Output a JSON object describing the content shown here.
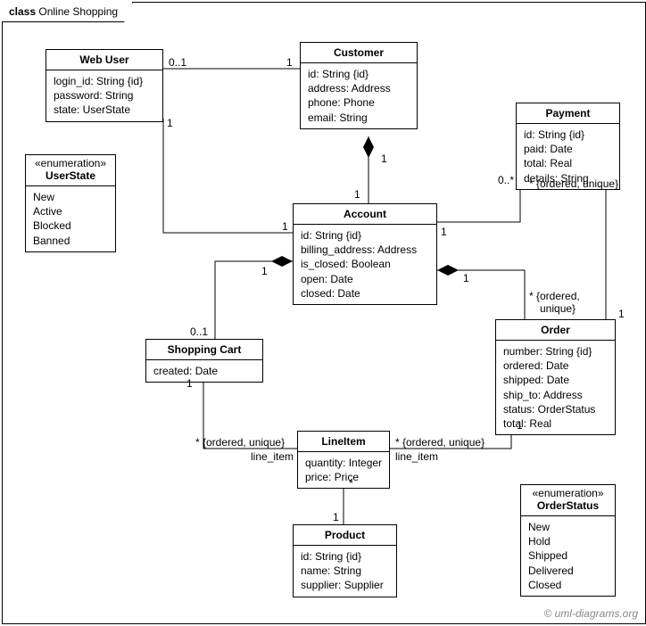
{
  "frame": {
    "label_bold": "class",
    "label_name": "Online Shopping"
  },
  "classes": {
    "webUser": {
      "name": "Web User",
      "attrs": [
        "login_id: String {id}",
        "password: String",
        "state: UserState"
      ]
    },
    "userState": {
      "stereotype": "«enumeration»",
      "name": "UserState",
      "attrs": [
        "New",
        "Active",
        "Blocked",
        "Banned"
      ]
    },
    "customer": {
      "name": "Customer",
      "attrs": [
        "id: String {id}",
        "address: Address",
        "phone: Phone",
        "email: String"
      ]
    },
    "account": {
      "name": "Account",
      "attrs": [
        "id: String {id}",
        "billing_address: Address",
        "is_closed: Boolean",
        "open: Date",
        "closed: Date"
      ]
    },
    "shoppingCart": {
      "name": "Shopping Cart",
      "attrs": [
        "created: Date"
      ]
    },
    "payment": {
      "name": "Payment",
      "attrs": [
        "id: String {id}",
        "paid: Date",
        "total: Real",
        "details: String"
      ]
    },
    "order": {
      "name": "Order",
      "attrs": [
        "number: String {id}",
        "ordered: Date",
        "shipped: Date",
        "ship_to: Address",
        "status: OrderStatus",
        "total: Real"
      ]
    },
    "lineItem": {
      "name": "LineItem",
      "attrs": [
        "quantity: Integer",
        "price: Price"
      ]
    },
    "product": {
      "name": "Product",
      "attrs": [
        "id: String {id}",
        "name: String",
        "supplier: Supplier"
      ]
    },
    "orderStatus": {
      "stereotype": "«enumeration»",
      "name": "OrderStatus",
      "attrs": [
        "New",
        "Hold",
        "Shipped",
        "Delivered",
        "Closed"
      ]
    }
  },
  "labels": {
    "mult_0_1_a": "0..1",
    "mult_1_a": "1",
    "mult_1_b": "1",
    "mult_1_c": "1",
    "mult_1_d": "1",
    "mult_1_e": "1",
    "mult_1_f": "1",
    "mult_1_g": "1",
    "mult_1_h": "1",
    "mult_1_i": "1",
    "mult_1_j": "1",
    "mult_1_k": "1",
    "mult_1_l": "1",
    "mult_0_1_b": "0..1",
    "mult_0_star": "0..*",
    "star_ou_1": "* {ordered, unique}",
    "star_ou_2": "* {ordered, unique}",
    "star_ou_3": "* {ordered,",
    "star_ou_3b": "unique}",
    "star_ou_4": "* {ordered, unique}",
    "line_item_1": "line_item",
    "line_item_2": "line_item",
    "star_plain": "*"
  },
  "copyright": "© uml-diagrams.org"
}
